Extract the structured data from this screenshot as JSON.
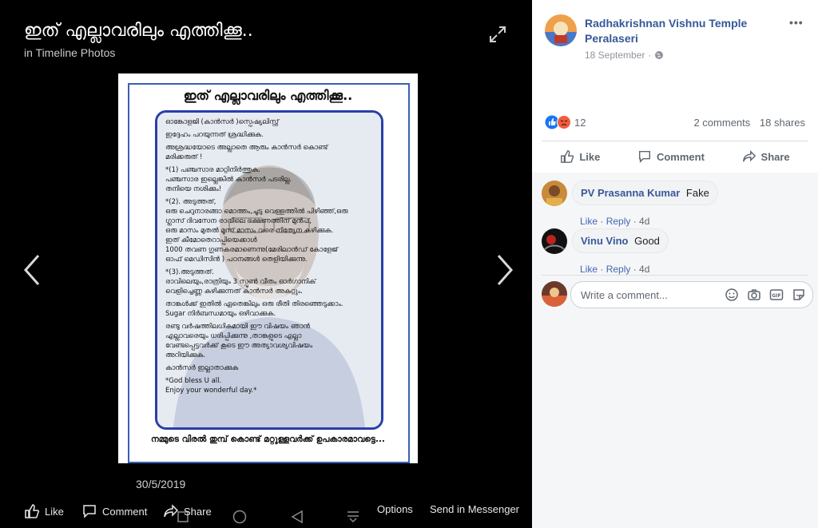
{
  "viewer": {
    "title": "ഇത് എല്ലാവരിലും എത്തിക്കൂ..",
    "album": "in Timeline Photos",
    "date": "30/5/2019",
    "poster": {
      "heading": "ഇത് എല്ലാവരിലും എത്തിക്കൂ..",
      "lines": [
        "ഓങ്കോളജി (കാൻസർ )സ്പെഷ്യലിസ്റ്റ്",
        "ഇദ്ദേഹം പറയുന്നത് ശ്രദ്ധിക്കുക.",
        "അശ്രദ്ധയോടെ അല്ലാതെ ആരും കാൻസർ കൊണ്ട്\nമരിക്കരുത് !",
        "*(1) പഞ്ചസാര മാറ്റിനിർത്തുക.\nപഞ്ചസാര ഇല്ലെങ്കിൽ കാൻസർ പടരില്ല.\nതനിയെ നശിക്കും!",
        "*(2). അടുത്തത്,\nഒരു ചെറുനാരങ്ങാ മൊത്തം,ചൂടു വെള്ളത്തിൽ പിഴിഞ്ഞ്,ഒരു\nഗ്ലാസ് ദിവസേന രാവിലെ ഭക്ഷണത്തിന് മുൻപ്,\nഒരു മാസം മുതൽ മൂന്ന് മാസം വരെ നിത്യേന കഴിക്കുക.\nഇത് കീമോതെറാപ്പിയെക്കാൾ\n1000 തവണ ഗുണകരമാണെന്നു(മേരിലാൻഡ് കോളേജ്\nഓഫ് മെഡിസിൻ ) പഠനങ്ങൾ തെളിയിക്കുന്നു.",
        "*(3).അടുത്തത്.\nരാവിലെയും,രാത്രിയും 3 സ്പൂൺ വീതം ഓർഗാനിക്\nവെളിച്ചെണ്ണ കഴിക്കുന്നത് കാൻസർ അകറ്റും.",
        "താങ്കൾക്ക് ഇതിൽ ഏതെങ്കിലും ഒരു രീതി തിരഞ്ഞെടുക്കാം.\nSugar നിർബന്ധമായും ഒഴിവാക്കുക.",
        "രണ്ടു വർഷത്തിലധികമായി ഈ വിഷയം ഞാൻ\nഎല്ലാവരെയും ധരിപ്പിക്കുന്നു ,താങ്കളുടെ എല്ലാ\nവേണ്ടപ്പെട്ടവർക്ക് കൂടെ ഈ അത്യാവശ്യവിഷയം\nഅറിയിക്കുക.",
        "കാൻസർ ഇല്ലാതാക്കുക",
        "*God bless U all.\nEnjoy your wonderful day.*"
      ],
      "footer": "നമ്മുടെ വിരൽ തുമ്പ് കൊണ്ട് മറ്റുള്ളവർക്ക് ഉപകാരമാവട്ടെ..."
    },
    "bottom": {
      "like": "Like",
      "comment": "Comment",
      "share": "Share",
      "options": "Options",
      "send": "Send in Messenger"
    }
  },
  "post": {
    "page_name": "Radhakrishnan Vishnu Temple Peralaseri",
    "time": "18 September",
    "reactions_count": "12",
    "comments_count": "2 comments",
    "shares_count": "18 shares",
    "actions": {
      "like": "Like",
      "comment": "Comment",
      "share": "Share"
    }
  },
  "comments": [
    {
      "author": "PV Prasanna Kumar",
      "text": "Fake",
      "like": "Like",
      "reply": "Reply",
      "age": "4d"
    },
    {
      "author": "Vinu Vino",
      "text": "Good",
      "like": "Like",
      "reply": "Reply",
      "age": "4d"
    }
  ],
  "composer": {
    "placeholder": "Write a comment..."
  },
  "colors": {
    "link": "#365899",
    "like_blue": "#1877f2",
    "angry": "#f25c3f",
    "viewer_bg": "#000000"
  }
}
